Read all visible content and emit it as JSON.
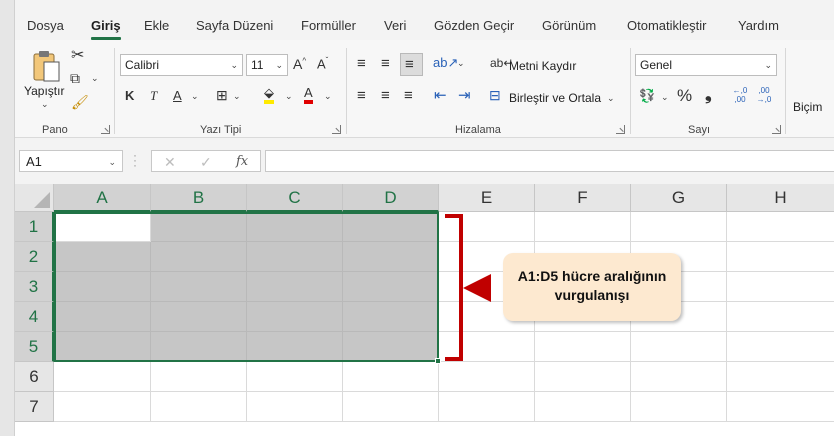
{
  "menu": {
    "tabs": [
      {
        "label": "Dosya"
      },
      {
        "label": "Giriş"
      },
      {
        "label": "Ekle"
      },
      {
        "label": "Sayfa Düzeni"
      },
      {
        "label": "Formüller"
      },
      {
        "label": "Veri"
      },
      {
        "label": "Gözden Geçir"
      },
      {
        "label": "Görünüm"
      },
      {
        "label": "Otomatikleştir"
      },
      {
        "label": "Yardım"
      }
    ],
    "active_tab": "Giriş"
  },
  "ribbon": {
    "clipboard": {
      "paste_label": "Yapıştır",
      "group_label": "Pano"
    },
    "font": {
      "font_name": "Calibri",
      "font_size": "11",
      "bold": "K",
      "italic": "T",
      "underline": "A",
      "group_label": "Yazı Tipi",
      "grow": "A^",
      "shrink": "A˅"
    },
    "alignment": {
      "wrap_text": "Metni Kaydır",
      "merge_center": "Birleştir ve Ortala",
      "group_label": "Hizalama"
    },
    "number": {
      "format": "Genel",
      "percent": "%",
      "comma": "❟",
      "inc_decimal": "←,0 ,00",
      "dec_decimal": ",00 →,0",
      "group_label": "Sayı"
    },
    "styles": {
      "cond_format_partial": "Biçim"
    }
  },
  "formula_bar": {
    "name_box": "A1",
    "cancel": "✕",
    "enter": "✓",
    "fx": "fx",
    "formula": ""
  },
  "sheet": {
    "columns": [
      "A",
      "B",
      "C",
      "D",
      "E",
      "F",
      "G",
      "H"
    ],
    "rows": [
      "1",
      "2",
      "3",
      "4",
      "5",
      "6",
      "7"
    ],
    "selection": "A1:D5"
  },
  "annotation": {
    "line1": "A1:D5 hücre aralığının",
    "line2": "vurgulanışı"
  },
  "colors": {
    "accent": "#217346",
    "highlight": "#c6c6c6",
    "annotation_red": "#c00000",
    "callout_fill": "#fde9d0"
  }
}
